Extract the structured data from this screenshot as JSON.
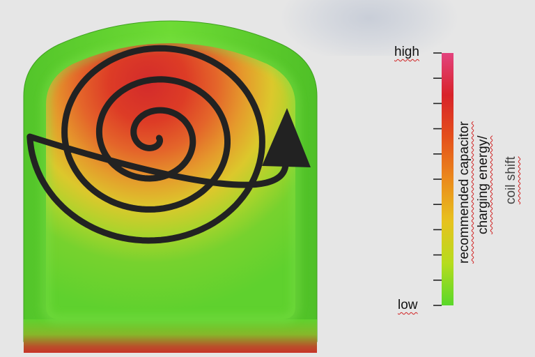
{
  "legend": {
    "high_label": "high",
    "low_label": "low",
    "title_line1": "recommended capacitor",
    "title_line2": "charging energy/",
    "title_line3": "coil shift",
    "gradient_colors": [
      "#5ad82a",
      "#b6dc1e",
      "#e7c21e",
      "#eb8a1c",
      "#e4501c",
      "#d8232a",
      "#e3437e"
    ],
    "tick_count": 11
  },
  "part": {
    "shell_color": "#5fd12e",
    "heat_colors": [
      "#d32b2b",
      "#e25a22",
      "#e8912a",
      "#e2c42c",
      "#b4d62c",
      "#70d32e"
    ],
    "spiral_color": "#222222",
    "spiral_icon": "spiral-arrow-icon"
  }
}
